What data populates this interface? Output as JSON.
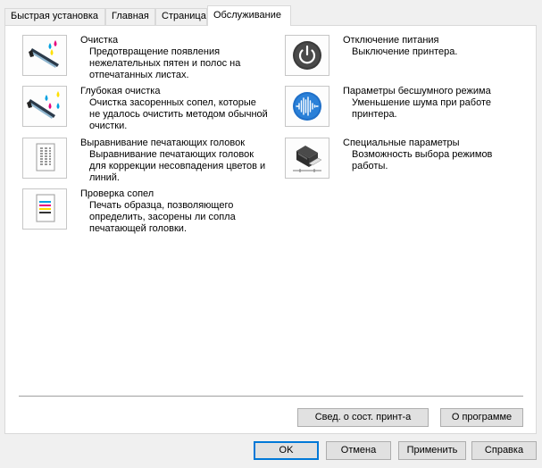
{
  "tabs": [
    {
      "label": "Быстрая установка"
    },
    {
      "label": "Главная"
    },
    {
      "label": "Страница"
    },
    {
      "label": "Обслуживание"
    }
  ],
  "left_items": [
    {
      "title": "Очистка",
      "desc": [
        "Предотвращение появления",
        "нежелательных пятен и полос на",
        "отпечатанных листах."
      ],
      "icon": "cleaning-icon"
    },
    {
      "title": "Глубокая очистка",
      "desc": [
        "Очистка засоренных сопел, которые",
        "не удалось очистить методом обычной",
        "очистки."
      ],
      "icon": "deep-cleaning-icon"
    },
    {
      "title": "Выравнивание печатающих головок",
      "desc": [
        "Выравнивание печатающих головок",
        "для коррекции несовпадения цветов и",
        "линий."
      ],
      "icon": "alignment-icon"
    },
    {
      "title": "Проверка сопел",
      "desc": [
        "Печать образца, позволяющего",
        "определить, засорены ли сопла",
        "печатающей головки."
      ],
      "icon": "nozzle-check-icon"
    }
  ],
  "right_items": [
    {
      "title": "Отключение питания",
      "desc": [
        "Выключение принтера."
      ],
      "icon": "power-icon"
    },
    {
      "title": "Параметры бесшумного режима",
      "desc": [
        "Уменьшение шума при работе",
        "принтера."
      ],
      "icon": "quiet-mode-icon"
    },
    {
      "title": "Специальные параметры",
      "desc": [
        "Возможность выбора режимов",
        "работы."
      ],
      "icon": "printer-settings-icon"
    }
  ],
  "panel_buttons": {
    "status": "Свед. о сост. принт-а",
    "about": "О программе"
  },
  "dialog_buttons": {
    "ok": "OK",
    "cancel": "Отмена",
    "apply": "Применить",
    "help": "Справка"
  }
}
